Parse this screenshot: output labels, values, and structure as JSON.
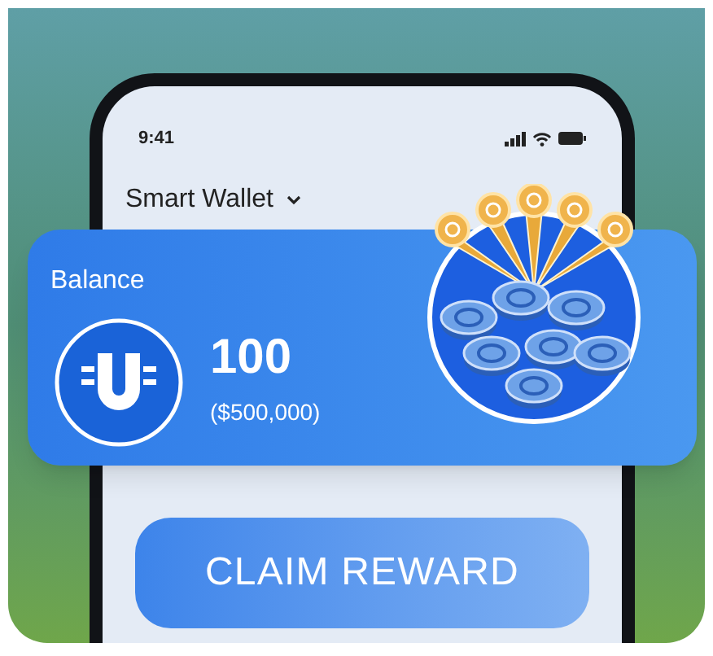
{
  "status_bar": {
    "time": "9:41"
  },
  "wallet_selector": {
    "label": "Smart Wallet"
  },
  "balance_card": {
    "label": "Balance",
    "amount": "100",
    "fiat_value": "($500,000)"
  },
  "claim_button": {
    "label": "CLAIM REWARD"
  }
}
